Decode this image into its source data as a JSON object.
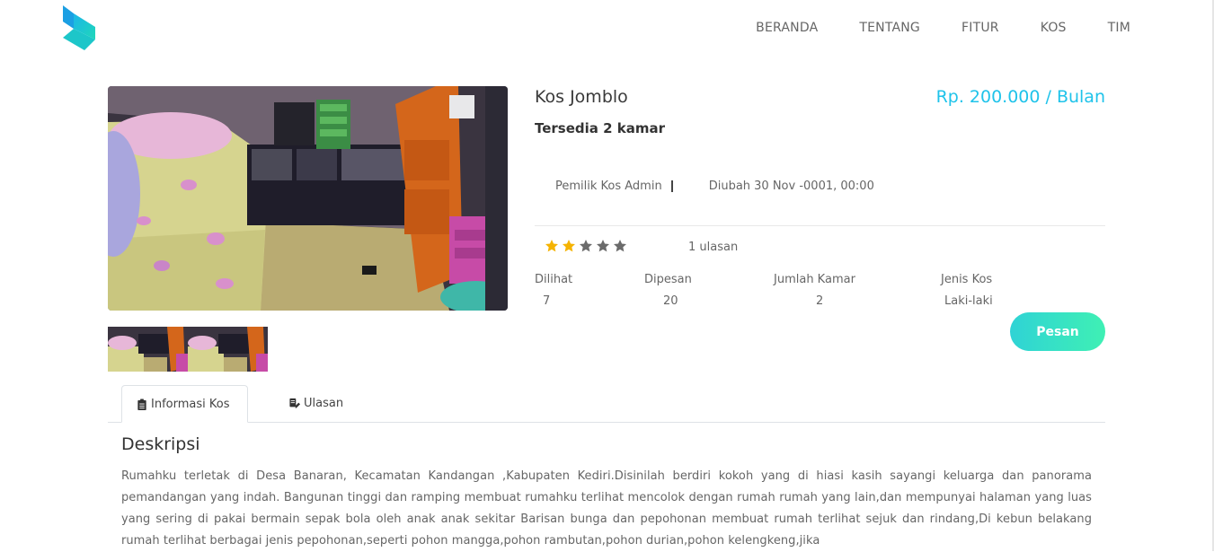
{
  "nav": {
    "items": [
      "BERANDA",
      "TENTANG",
      "FITUR",
      "KOS",
      "TIM"
    ]
  },
  "listing": {
    "title": "Kos Jomblo",
    "price": "Rp. 200.000 / Bulan",
    "availability": "Tersedia 2 kamar",
    "owner": "Pemilik Kos Admin",
    "updated": "Diubah 30 Nov -0001, 00:00",
    "rating": 2,
    "rating_max": 5,
    "reviews": "1 ulasan",
    "stats": [
      {
        "label": "Dilihat",
        "value": "7"
      },
      {
        "label": "Dipesan",
        "value": "20"
      },
      {
        "label": "Jumlah Kamar",
        "value": "2"
      },
      {
        "label": "Jenis Kos",
        "value": "Laki-laki"
      }
    ],
    "book_label": "Pesan"
  },
  "tabs": [
    {
      "label": "Informasi Kos",
      "icon": "clipboard-icon"
    },
    {
      "label": "Ulasan",
      "icon": "review-icon"
    }
  ],
  "description": {
    "heading": "Deskripsi",
    "text": "Rumahku terletak di Desa Banaran, Kecamatan Kandangan ,Kabupaten Kediri.Disinilah berdiri kokoh yang di hiasi kasih sayangi keluarga dan panorama pemandangan yang indah. Bangunan tinggi dan ramping membuat rumahku terlihat mencolok dengan rumah rumah yang lain,dan mempunyai halaman yang luas yang sering di pakai bermain sepak bola oleh anak anak sekitar Barisan bunga dan pepohonan membuat rumah terlihat sejuk dan rindang,Di kebun belakang rumah terlihat berbagai jenis pepohonan,seperti pohon mangga,pohon rambutan,pohon durian,pohon kelengkeng,jika"
  },
  "colors": {
    "accent": "#1fc3ea",
    "star_on": "#f5b301",
    "star_off": "#6b6b6b",
    "button_from": "#2fd3d5",
    "button_to": "#3ff0b4"
  }
}
